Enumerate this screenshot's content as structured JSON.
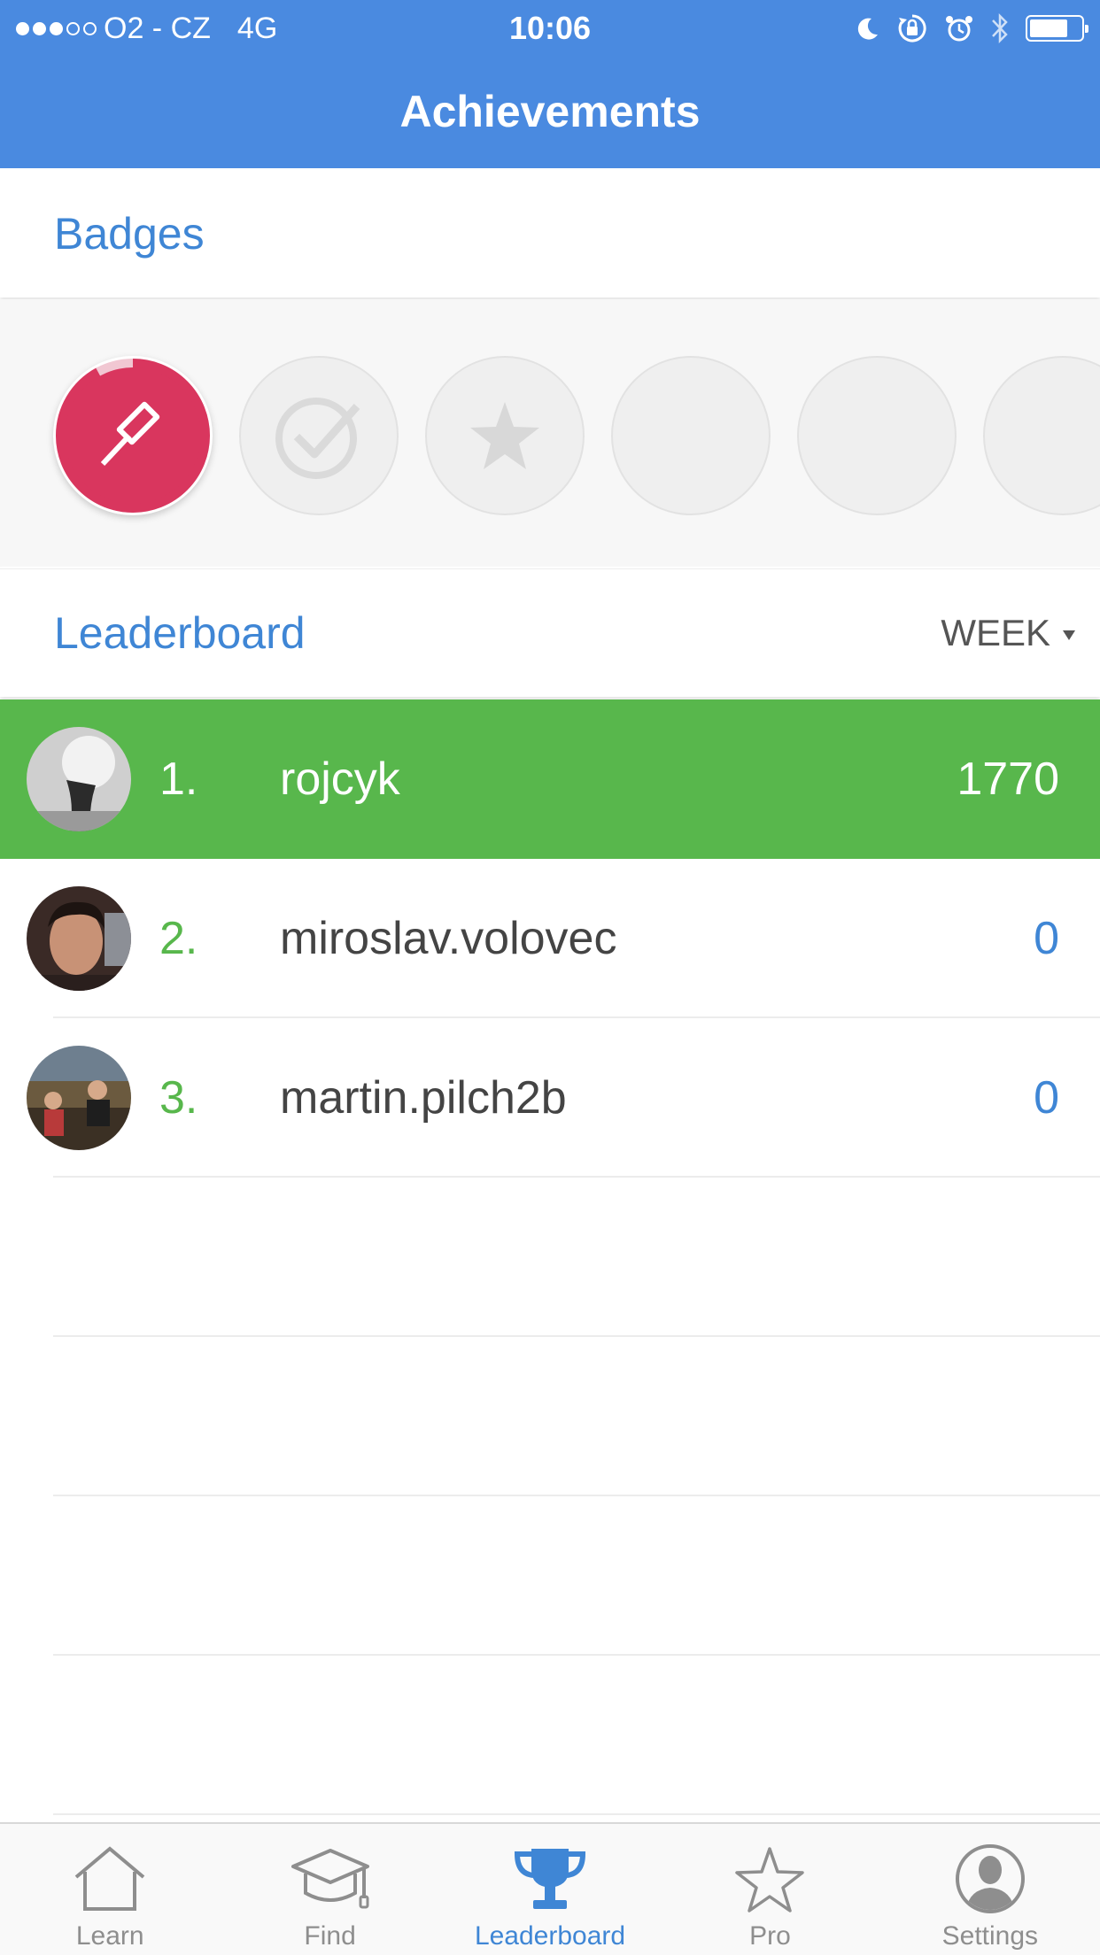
{
  "status_bar": {
    "carrier": "O2 - CZ",
    "network": "4G",
    "time": "10:06",
    "signal_bars": 3,
    "signal_total": 5,
    "battery_level": 0.75,
    "icons": [
      "moon-icon",
      "orientation-lock-icon",
      "alarm-icon",
      "bluetooth-icon",
      "battery-icon"
    ]
  },
  "nav": {
    "title": "Achievements"
  },
  "badges": {
    "title": "Badges",
    "items": [
      {
        "icon": "gavel-icon",
        "state": "earned",
        "color": "#d9365e",
        "progress": 0.92
      },
      {
        "icon": "checkmark-icon",
        "state": "locked"
      },
      {
        "icon": "star-icon",
        "state": "locked"
      },
      {
        "icon": "",
        "state": "locked"
      },
      {
        "icon": "",
        "state": "locked"
      },
      {
        "icon": "",
        "state": "locked"
      }
    ]
  },
  "leaderboard": {
    "title": "Leaderboard",
    "period": "WEEK",
    "rows": [
      {
        "rank": "1.",
        "name": "rojcyk",
        "score": "1770",
        "highlight": true
      },
      {
        "rank": "2.",
        "name": "miroslav.volovec",
        "score": "0"
      },
      {
        "rank": "3.",
        "name": "martin.pilch2b",
        "score": "0"
      }
    ]
  },
  "tabbar": {
    "tabs": [
      {
        "label": "Learn",
        "icon": "house-icon"
      },
      {
        "label": "Find",
        "icon": "graduation-cap-icon"
      },
      {
        "label": "Leaderboard",
        "icon": "trophy-icon",
        "active": true
      },
      {
        "label": "Pro",
        "icon": "star-icon"
      },
      {
        "label": "Settings",
        "icon": "person-icon"
      }
    ]
  },
  "colors": {
    "header_blue": "#4a8ae0",
    "accent_blue": "#3f86d5",
    "leader_green": "#58b74c",
    "badge_red": "#d9365e"
  }
}
